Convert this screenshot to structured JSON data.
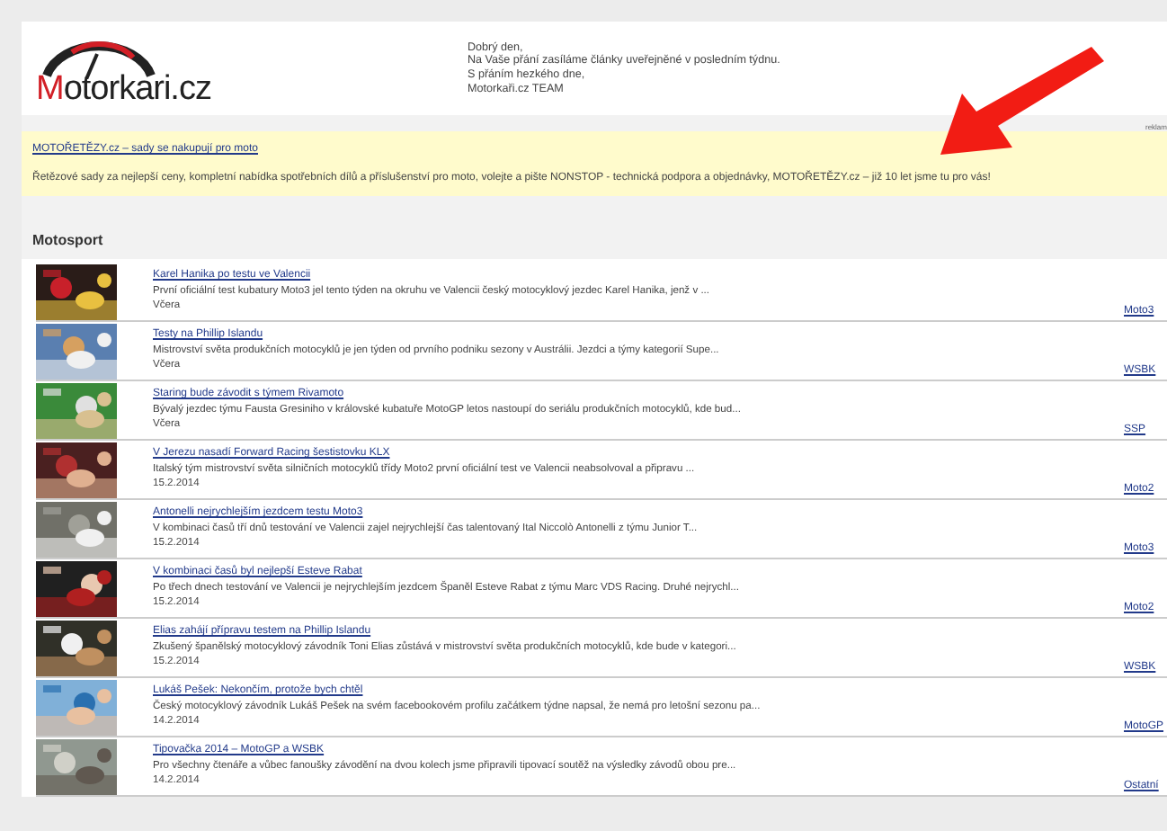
{
  "header": {
    "logo": {
      "initial": "M",
      "rest": "otorkari.cz"
    },
    "greeting": [
      "Dobrý den,",
      "Na Vaše přání zasíláme články uveřejněné v posledním týdnu.",
      "S přáním hezkého dne,",
      "Motorkaři.cz TEAM"
    ]
  },
  "ad": {
    "label": "reklam",
    "link": "MOTOŘETĚZY.cz – sady se nakupují pro moto",
    "text": "Řetězové sady za nejlepší ceny, kompletní nabídka spotřebních dílů a příslušenství pro moto, volejte a pište NONSTOP - technická podpora a objednávky, MOTOŘETĚZY.cz – již 10 let jsme tu pro vás!"
  },
  "section": {
    "title": "Motosport"
  },
  "articles": [
    {
      "title": "Karel Hanika po testu ve Valencii",
      "summary": "První oficiální test kubatury Moto3 jel tento týden na okruhu ve Valencii český motocyklový jezdec Karel Hanika, jenž v ...",
      "date": "Včera",
      "category": "Moto3"
    },
    {
      "title": "Testy na Phillip Islandu",
      "summary": "Mistrovství světa produkčních motocyklů je jen týden od prvního podniku sezony v Austrálii. Jezdci a týmy kategorií Supe...",
      "date": "Včera",
      "category": "WSBK"
    },
    {
      "title": "Staring bude závodit s týmem Rivamoto",
      "summary": "Bývalý jezdec týmu Fausta Gresiniho v královské kubatuře MotoGP letos nastoupí do seriálu produkčních motocyklů, kde bud...",
      "date": "Včera",
      "category": "SSP"
    },
    {
      "title": "V Jerezu nasadí Forward Racing šestistovku KLX",
      "summary": "Italský tým mistrovství světa silničních motocyklů třídy Moto2 první oficiální test ve Valencii neabsolvoval a připravu ...",
      "date": "15.2.2014",
      "category": "Moto2"
    },
    {
      "title": "Antonelli nejrychlejším jezdcem testu Moto3",
      "summary": "V kombinaci časů tří dnů testování ve Valencii zajel nejrychlejší čas talentovaný Ital Niccolò Antonelli z týmu Junior T...",
      "date": "15.2.2014",
      "category": "Moto3"
    },
    {
      "title": "V kombinaci časů byl nejlepší Esteve Rabat",
      "summary": "Po třech dnech testování ve Valencii je nejrychlejším jezdcem Španěl Esteve Rabat z týmu Marc VDS Racing. Druhé nejrychl...",
      "date": "15.2.2014",
      "category": "Moto2"
    },
    {
      "title": "Elias zahájí přípravu testem na Phillip Islandu",
      "summary": "Zkušený španělský motocyklový závodník Toni Elias zůstává v mistrovství světa produkčních motocyklů, kde bude v kategori...",
      "date": "15.2.2014",
      "category": "WSBK"
    },
    {
      "title": "Lukáš Pešek: Nekončím, protože bych chtěl",
      "summary": "Český motocyklový závodník Lukáš Pešek na svém facebookovém profilu začátkem týdne napsal, že nemá pro letošní sezonu pa...",
      "date": "14.2.2014",
      "category": "MotoGP"
    },
    {
      "title": "Tipovačka 2014 – MotoGP a WSBK",
      "summary": "Pro všechny čtenáře a vůbec fanoušky závodění na dvou kolech jsme připravili tipovací soutěž na výsledky závodů obou pre...",
      "date": "14.2.2014",
      "category": "Ostatní"
    }
  ]
}
